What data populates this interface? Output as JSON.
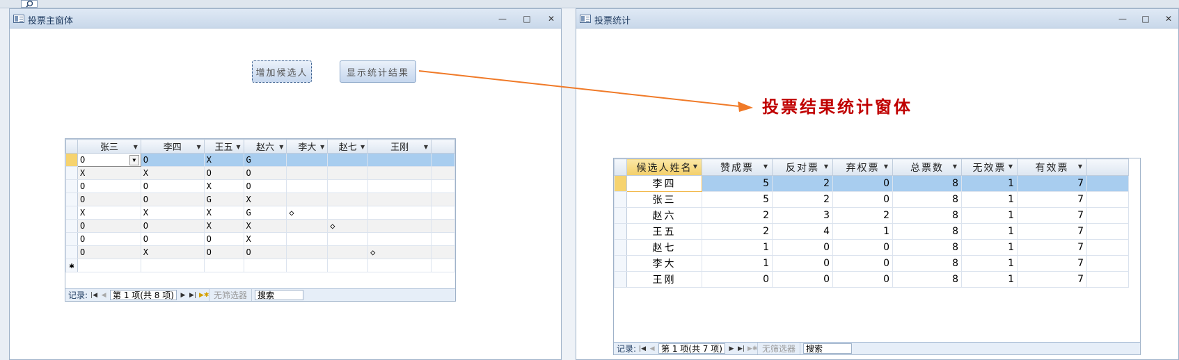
{
  "main_window": {
    "title": "投票主窗体",
    "add_button": "增加候选人",
    "show_button": "显示统计结果",
    "columns": [
      "张三",
      "李四",
      "王五",
      "赵六",
      "李大",
      "赵七",
      "王刚"
    ],
    "rows": [
      [
        "O",
        "O",
        "X",
        "G",
        "",
        "",
        ""
      ],
      [
        "X",
        "X",
        "O",
        "O",
        "",
        "",
        ""
      ],
      [
        "O",
        "O",
        "X",
        "O",
        "",
        "",
        ""
      ],
      [
        "O",
        "O",
        "G",
        "X",
        "",
        "",
        ""
      ],
      [
        "X",
        "X",
        "X",
        "G",
        "◇",
        "",
        ""
      ],
      [
        "O",
        "O",
        "X",
        "X",
        "",
        "◇",
        ""
      ],
      [
        "O",
        "O",
        "O",
        "X",
        "",
        "",
        ""
      ],
      [
        "O",
        "X",
        "O",
        "O",
        "",
        "",
        "◇"
      ]
    ],
    "new_row_marker": "✱",
    "nav": {
      "label": "记录:",
      "position": "第 1 项(共 8 项)",
      "filter": "无筛选器",
      "search": "搜索"
    }
  },
  "stats_window": {
    "title": "投票统计",
    "columns": [
      "候选人姓名",
      "赞成票",
      "反对票",
      "弃权票",
      "总票数",
      "无效票",
      "有效票"
    ],
    "rows": [
      [
        "李四",
        "5",
        "2",
        "0",
        "8",
        "1",
        "7"
      ],
      [
        "张三",
        "5",
        "2",
        "0",
        "8",
        "1",
        "7"
      ],
      [
        "赵六",
        "2",
        "3",
        "2",
        "8",
        "1",
        "7"
      ],
      [
        "王五",
        "2",
        "4",
        "1",
        "8",
        "1",
        "7"
      ],
      [
        "赵七",
        "1",
        "0",
        "0",
        "8",
        "1",
        "7"
      ],
      [
        "李大",
        "1",
        "0",
        "0",
        "8",
        "1",
        "7"
      ],
      [
        "王刚",
        "0",
        "0",
        "0",
        "8",
        "1",
        "7"
      ]
    ],
    "nav": {
      "label": "记录:",
      "position": "第 1 项(共 7 项)",
      "filter": "无筛选器",
      "search": "搜索"
    }
  },
  "annotation": "投票结果统计窗体",
  "window_controls": {
    "minimize": "—",
    "restore": "□",
    "close": "✕"
  },
  "colors": {
    "annotation": "#c00000",
    "arrow": "#f07a28",
    "selected_row": "#a8cdef",
    "current_record_selector": "#f6d36f"
  }
}
